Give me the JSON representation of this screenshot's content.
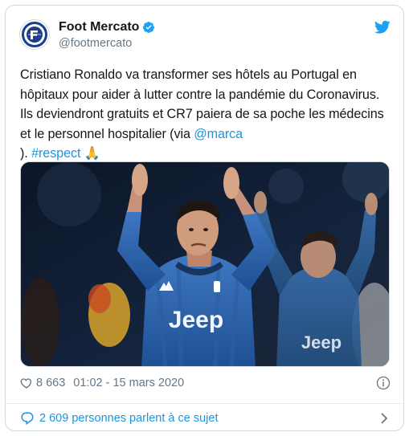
{
  "account": {
    "display_name": "Foot Mercato",
    "handle": "@footmercato",
    "verified": true
  },
  "tweet": {
    "lines": [
      [
        "Cristiano Ronaldo va transformer ses hôtels au Portugal en"
      ],
      [
        "hôpitaux pour aider à lutter contre la pandémie du Coronavirus."
      ],
      [
        "Ils deviendront gratuits et CR7 paiera de sa poche les médecins"
      ],
      [
        "et le personnel hospitalier (via ",
        "@marca"
      ],
      [
        "). ",
        "#respect",
        " 🙏"
      ]
    ]
  },
  "media": {
    "jersey_text_main": "Jeep",
    "jersey_text_second": "Jeep"
  },
  "meta": {
    "likes": "8 663",
    "timestamp": "01:02 - 15 mars 2020"
  },
  "footer": {
    "conversation": "2 609 personnes parlent à ce sujet"
  },
  "colors": {
    "link": "#1b95e0",
    "twitter_blue": "#1da1f2",
    "secondary_text": "#657786",
    "border": "#cfd9de"
  },
  "icons": [
    "foot-mercato-logo",
    "verified-badge-icon",
    "twitter-bird-icon",
    "heart-icon",
    "info-icon",
    "speech-bubble-icon",
    "chevron-right-icon",
    "praying-hands-emoji"
  ]
}
